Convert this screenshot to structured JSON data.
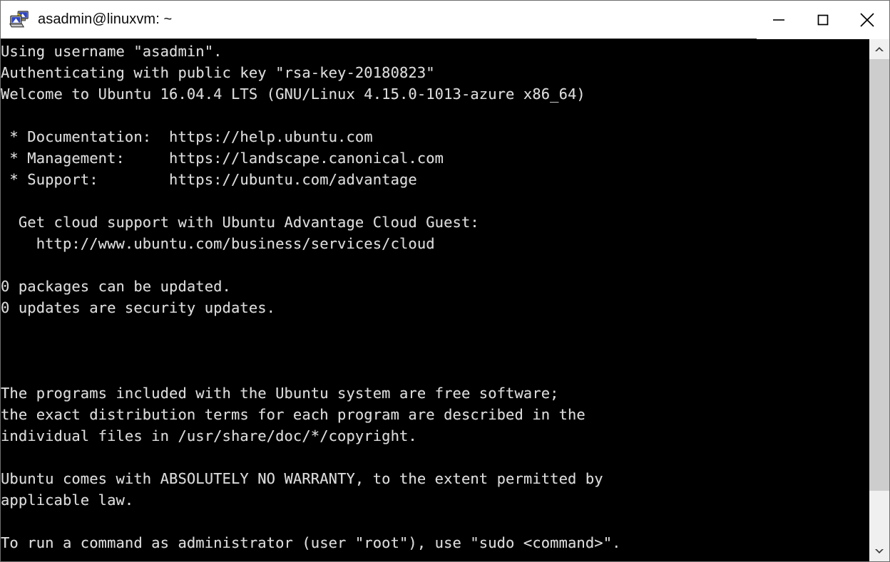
{
  "window": {
    "title": "asadmin@linuxvm: ~",
    "icon": "putty-terminal-icon",
    "controls": [
      {
        "name": "minimize-button",
        "glyph": "minimize"
      },
      {
        "name": "maximize-button",
        "glyph": "maximize"
      },
      {
        "name": "close-button",
        "glyph": "close"
      }
    ],
    "colors": {
      "titlebar_background": "#ffffff",
      "titlebar_text": "#0b0b0b",
      "terminal_background": "#000000",
      "terminal_text": "#d8d8d8",
      "scrollbar_track": "#f0f0f0",
      "scrollbar_thumb": "#cdcdcd"
    }
  },
  "terminal": {
    "lines": [
      "Using username \"asadmin\".",
      "Authenticating with public key \"rsa-key-20180823\"",
      "Welcome to Ubuntu 16.04.4 LTS (GNU/Linux 4.15.0-1013-azure x86_64)",
      "",
      " * Documentation:  https://help.ubuntu.com",
      " * Management:     https://landscape.canonical.com",
      " * Support:        https://ubuntu.com/advantage",
      "",
      "  Get cloud support with Ubuntu Advantage Cloud Guest:",
      "    http://www.ubuntu.com/business/services/cloud",
      "",
      "0 packages can be updated.",
      "0 updates are security updates.",
      "",
      "",
      "",
      "The programs included with the Ubuntu system are free software;",
      "the exact distribution terms for each program are described in the",
      "individual files in /usr/share/doc/*/copyright.",
      "",
      "Ubuntu comes with ABSOLUTELY NO WARRANTY, to the extent permitted by",
      "applicable law.",
      "",
      "To run a command as administrator (user \"root\"), use \"sudo <command>\"."
    ],
    "text": "Using username \"asadmin\".\nAuthenticating with public key \"rsa-key-20180823\"\nWelcome to Ubuntu 16.04.4 LTS (GNU/Linux 4.15.0-1013-azure x86_64)\n\n * Documentation:  https://help.ubuntu.com\n * Management:     https://landscape.canonical.com\n * Support:        https://ubuntu.com/advantage\n\n  Get cloud support with Ubuntu Advantage Cloud Guest:\n    http://www.ubuntu.com/business/services/cloud\n\n0 packages can be updated.\n0 updates are security updates.\n\n\n\nThe programs included with the Ubuntu system are free software;\nthe exact distribution terms for each program are described in the\nindividual files in /usr/share/doc/*/copyright.\n\nUbuntu comes with ABSOLUTELY NO WARRANTY, to the extent permitted by\napplicable law.\n\nTo run a command as administrator (user \"root\"), use \"sudo <command>\"."
  },
  "scrollbar": {
    "up_arrow": "chevron-up-icon",
    "down_arrow": "chevron-down-icon",
    "thumb_position": "top",
    "thumb_extent_percent": 89.5
  }
}
